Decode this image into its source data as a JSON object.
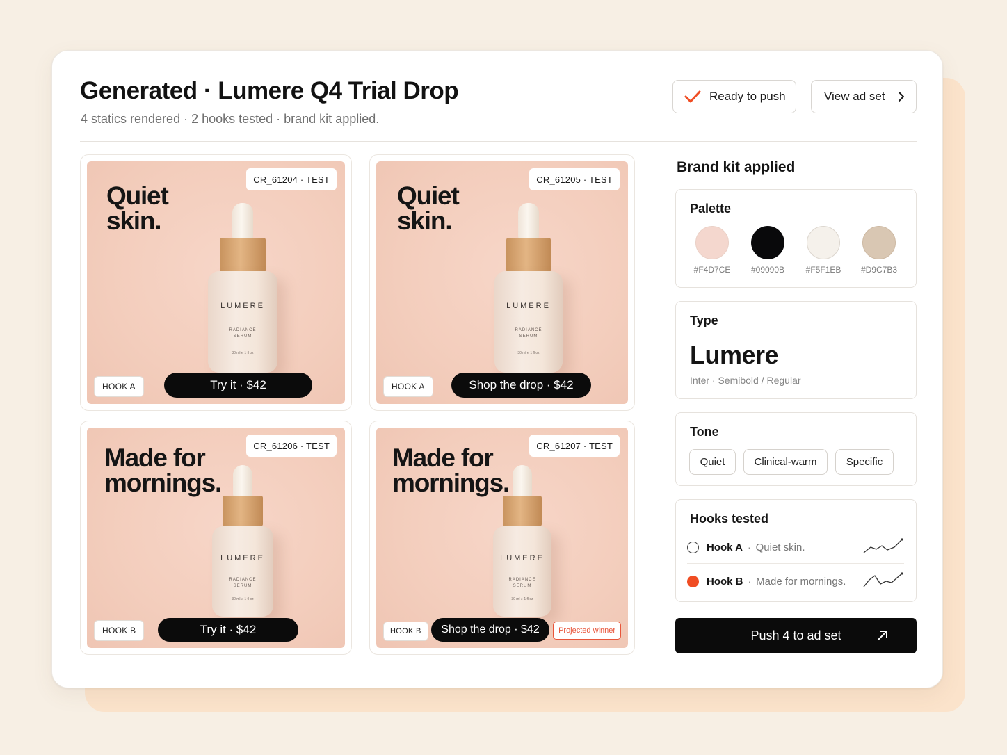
{
  "header": {
    "title": "Generated · Lumere Q4 Trial Drop",
    "subtitle": "4 statics rendered · 2 hooks tested · brand kit applied.",
    "ready_label": "Ready to push",
    "view_label": "View ad set"
  },
  "creatives": [
    {
      "id": "CR_61204 · TEST",
      "headline_1": "Quiet",
      "headline_2": "skin.",
      "hook": "HOOK A",
      "cta": "Try it · $42"
    },
    {
      "id": "CR_61205 · TEST",
      "headline_1": "Quiet",
      "headline_2": "skin.",
      "hook": "HOOK A",
      "cta": "Shop the drop · $42"
    },
    {
      "id": "CR_61206 · TEST",
      "headline_1": "Made for",
      "headline_2": "mornings.",
      "hook": "HOOK B",
      "cta": "Try it · $42"
    },
    {
      "id": "CR_61207 · TEST",
      "headline_1": "Made for",
      "headline_2": "mornings.",
      "hook": "HOOK B",
      "cta": "Shop the drop · $42",
      "winner": "Projected winner"
    }
  ],
  "bottle": {
    "brand": "LUMERE",
    "line_1": "RADIANCE",
    "line_2": "SERUM",
    "volume": "30 ml ℮ 1 fl oz"
  },
  "brand_kit": {
    "title": "Brand kit applied",
    "palette_title": "Palette",
    "palette": [
      {
        "hex": "#F4D7CE",
        "color": "#F4D7CE"
      },
      {
        "hex": "#09090B",
        "color": "#09090B"
      },
      {
        "hex": "#F5F1EB",
        "color": "#F5F1EB"
      },
      {
        "hex": "#D9C7B3",
        "color": "#D9C7B3"
      }
    ],
    "type_title": "Type",
    "type_name": "Lumere",
    "type_note": "Inter · Semibold / Regular",
    "tone_title": "Tone",
    "tones": [
      "Quiet",
      "Clinical-warm",
      "Specific"
    ],
    "hooks_title": "Hooks tested",
    "hooks": [
      {
        "name": "Hook A",
        "text": "Quiet skin.",
        "selected": false
      },
      {
        "name": "Hook B",
        "text": "Made for mornings.",
        "selected": true
      }
    ]
  },
  "push": {
    "label": "Push 4 to ad set"
  },
  "colors": {
    "accent": "#F04D23",
    "backdrop": "#FBE3CB",
    "ad_background": "#F3CDBC"
  }
}
